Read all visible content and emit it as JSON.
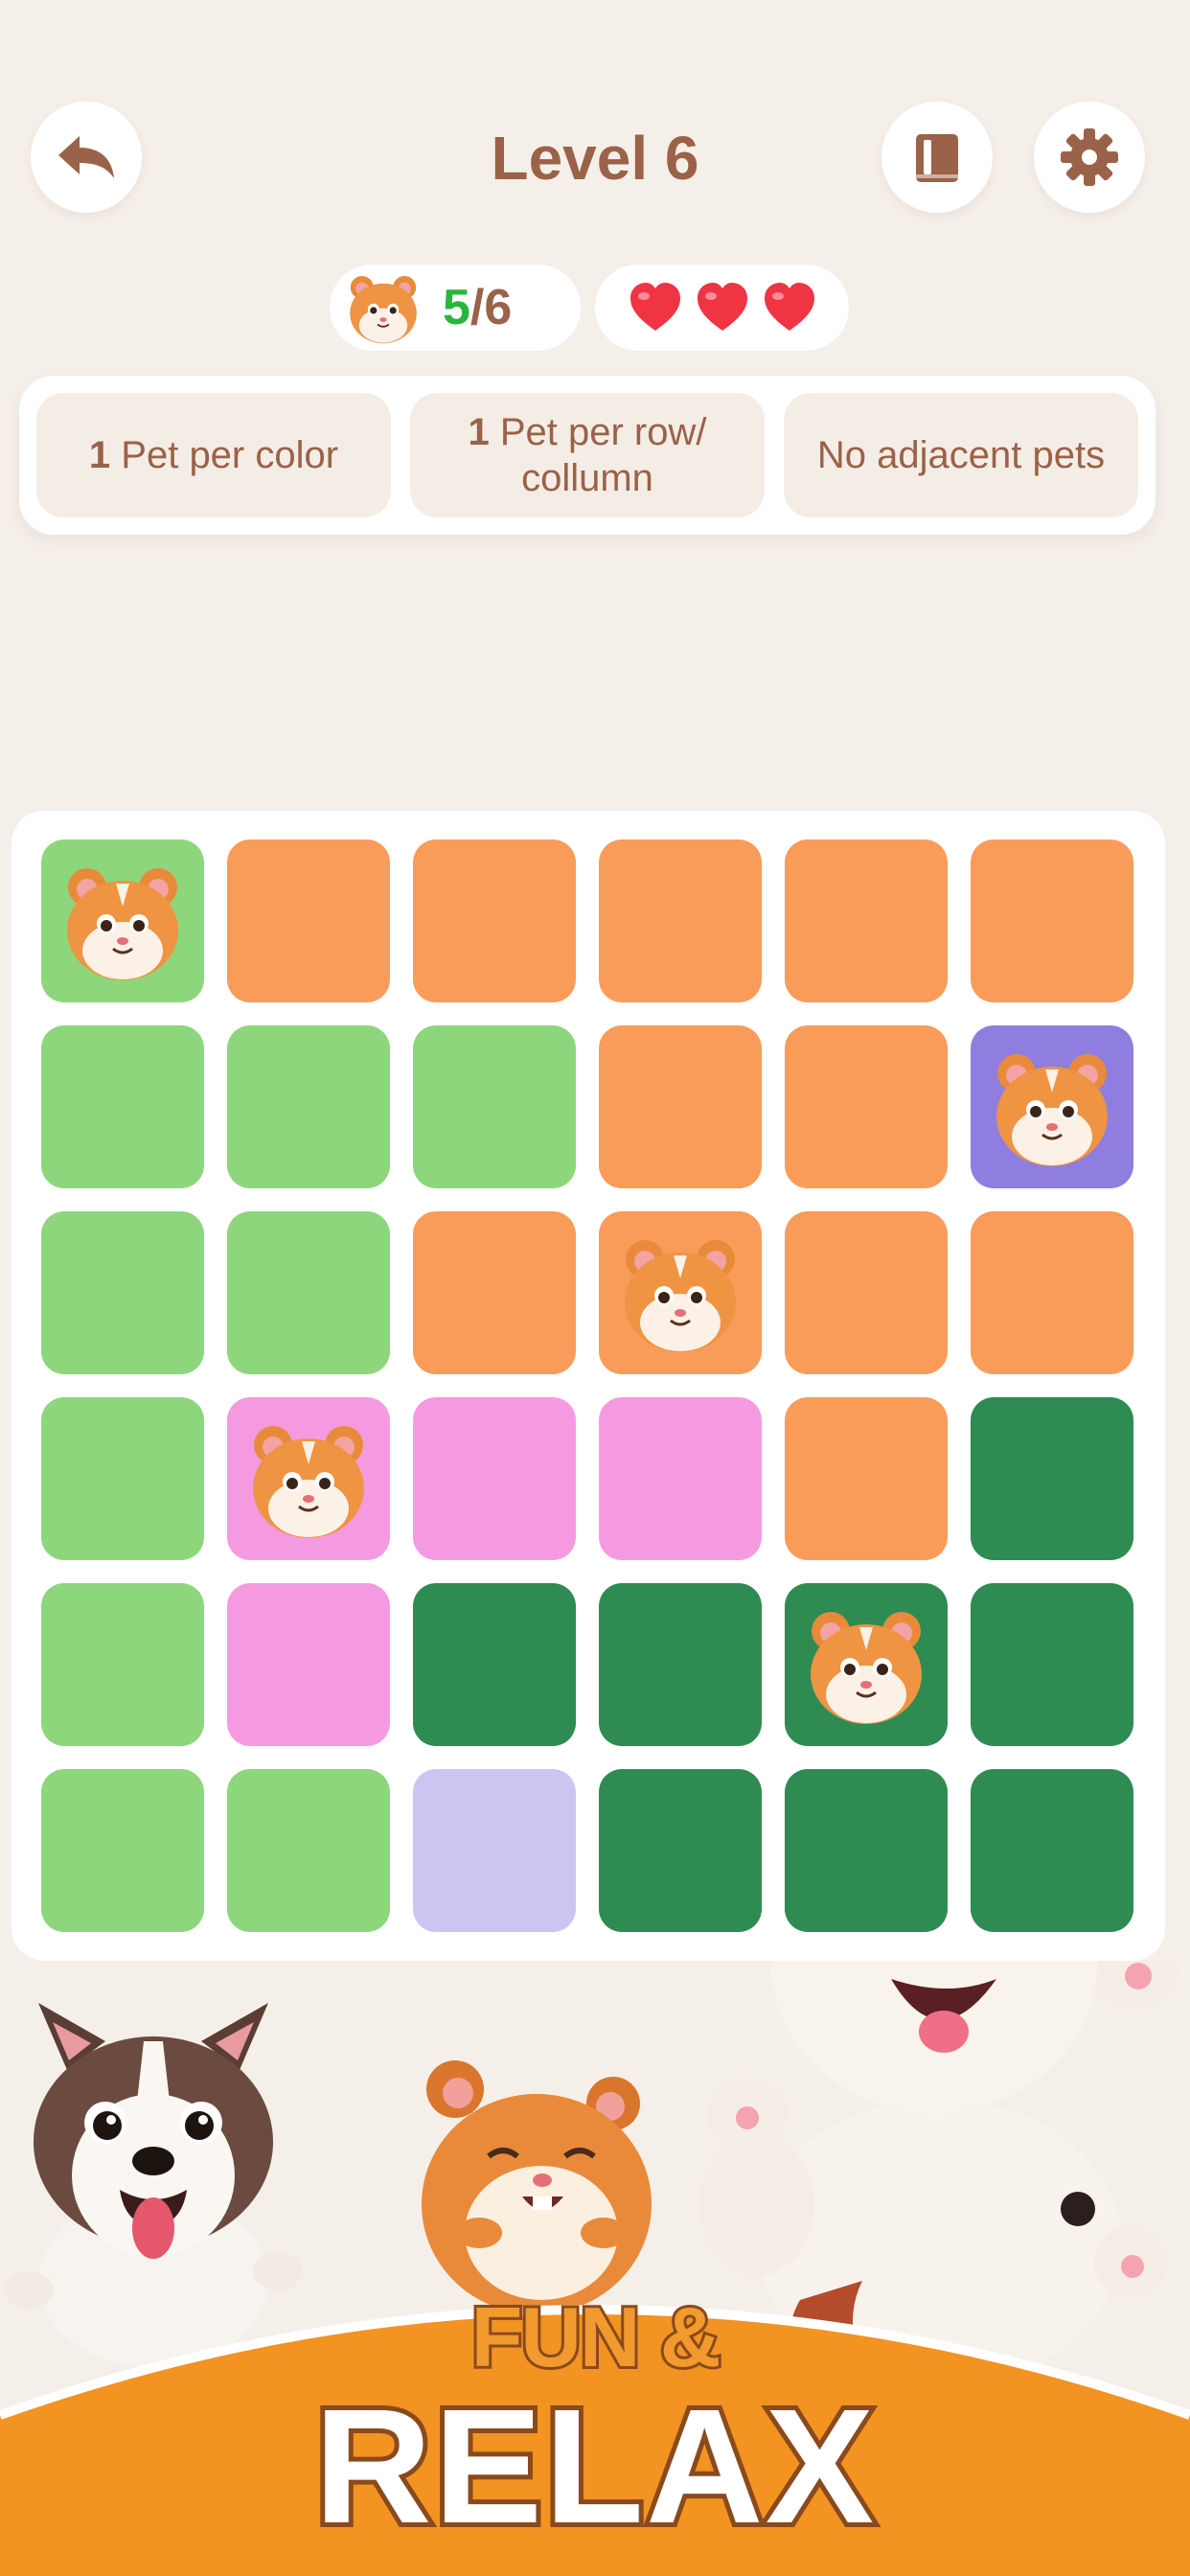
{
  "header": {
    "title": "Level 6",
    "back_icon": "undo-arrow-icon",
    "book_icon": "book-icon",
    "settings_icon": "gear-icon"
  },
  "status": {
    "progress_done": "5",
    "progress_total": "/6",
    "lives": 3
  },
  "rules": [
    {
      "bold": "1",
      "text": " Pet per color"
    },
    {
      "bold": "1",
      "text": " Pet per row/ collumn"
    },
    {
      "bold": "",
      "text": "No adjacent pets"
    }
  ],
  "colors": {
    "light_green": "#8dd67c",
    "orange": "#f99c5a",
    "purple": "#8f7ee0",
    "pink": "#f59ae0",
    "dark_green": "#2e8b52",
    "lavender": "#cdc4f2",
    "brand_brown": "#9a6248",
    "banner_orange": "#f29322"
  },
  "board": {
    "rows": 6,
    "cols": 6,
    "cells": [
      [
        "light_green",
        "orange",
        "orange",
        "orange",
        "orange",
        "orange"
      ],
      [
        "light_green",
        "light_green",
        "light_green",
        "orange",
        "orange",
        "purple"
      ],
      [
        "light_green",
        "light_green",
        "orange",
        "orange",
        "orange",
        "orange"
      ],
      [
        "light_green",
        "pink",
        "pink",
        "pink",
        "orange",
        "dark_green"
      ],
      [
        "light_green",
        "pink",
        "dark_green",
        "dark_green",
        "dark_green",
        "dark_green"
      ],
      [
        "light_green",
        "light_green",
        "lavender",
        "dark_green",
        "dark_green",
        "dark_green"
      ]
    ],
    "pets": [
      [
        0,
        0
      ],
      [
        1,
        5
      ],
      [
        2,
        3
      ],
      [
        3,
        1
      ],
      [
        4,
        4
      ]
    ]
  },
  "banner": {
    "line1": "FUN &",
    "line2": "RELAX"
  }
}
